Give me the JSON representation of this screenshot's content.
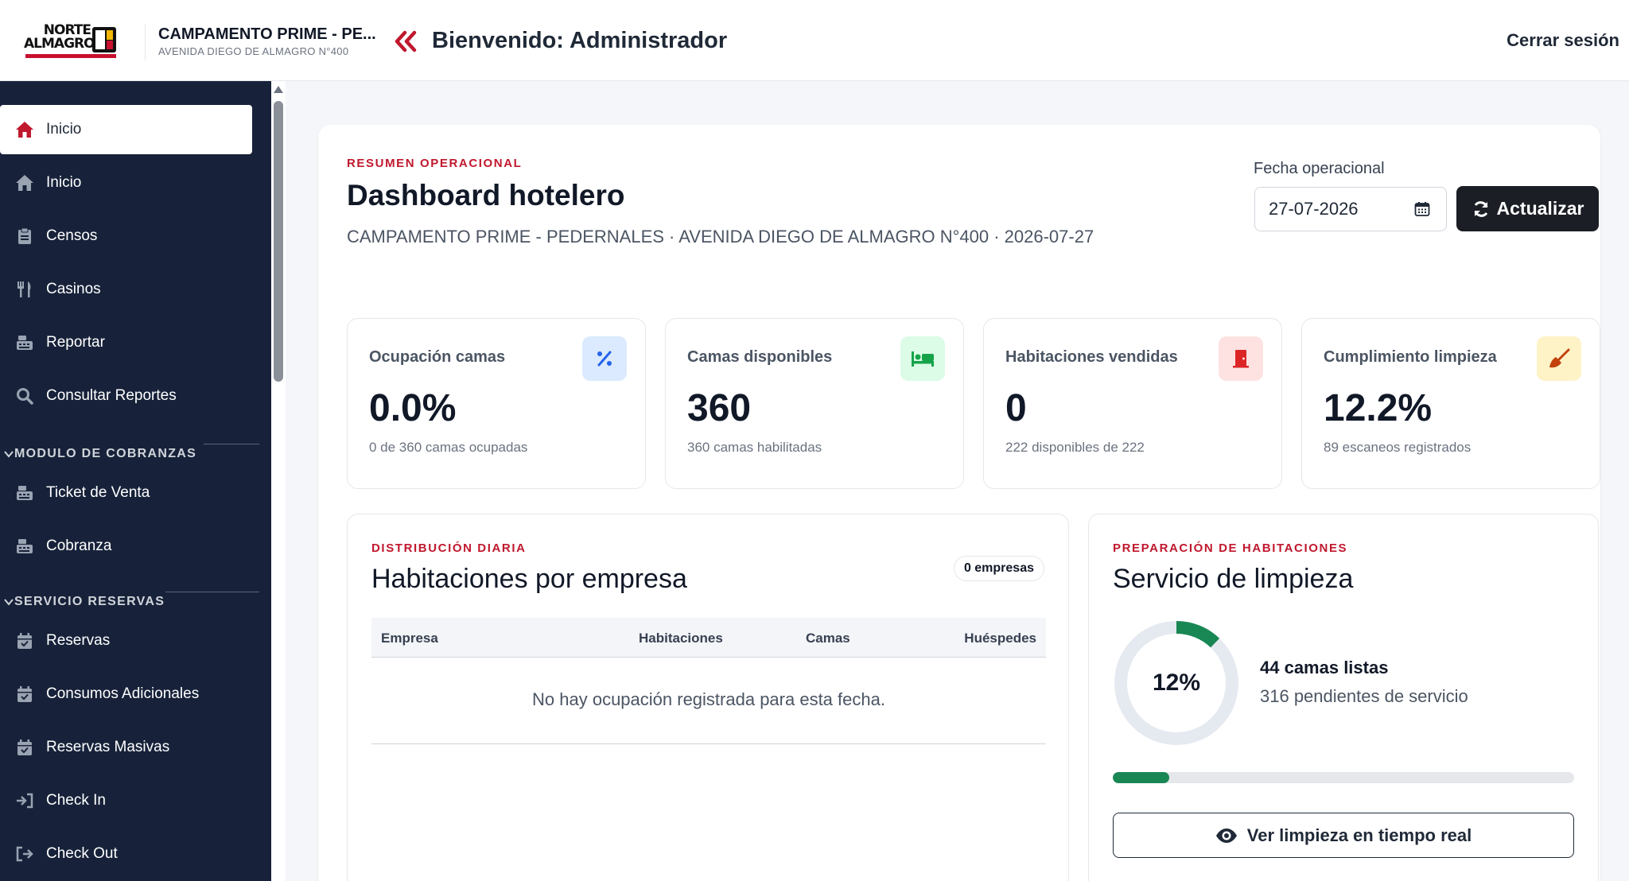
{
  "header": {
    "logo_line1": "NORTE",
    "logo_line2": "ALMAGRO",
    "camp_name": "CAMPAMENTO PRIME - PE...",
    "camp_address": "AVENIDA DIEGO DE ALMAGRO N°400",
    "welcome": "Bienvenido: Administrador",
    "logout": "Cerrar sesión"
  },
  "sidebar": {
    "items": [
      {
        "label": "Inicio",
        "icon": "home-icon",
        "active": true
      },
      {
        "label": "Inicio",
        "icon": "home-icon"
      },
      {
        "label": "Censos",
        "icon": "clipboard-icon"
      },
      {
        "label": "Casinos",
        "icon": "utensils-icon"
      },
      {
        "label": "Reportar",
        "icon": "cash-register-icon"
      },
      {
        "label": "Consultar Reportes",
        "icon": "search-icon"
      }
    ],
    "section_cobranzas": "MODULO DE COBRANZAS",
    "cobranzas_items": [
      {
        "label": "Ticket de Venta",
        "icon": "cash-register-icon"
      },
      {
        "label": "Cobranza",
        "icon": "cash-register-icon"
      }
    ],
    "section_reservas": "SERVICIO RESERVAS",
    "reservas_items": [
      {
        "label": "Reservas",
        "icon": "calendar-check-icon"
      },
      {
        "label": "Consumos Adicionales",
        "icon": "calendar-check-icon"
      },
      {
        "label": "Reservas Masivas",
        "icon": "calendar-check-icon"
      },
      {
        "label": "Check In",
        "icon": "sign-in-icon"
      },
      {
        "label": "Check Out",
        "icon": "sign-out-icon"
      }
    ]
  },
  "dashboard": {
    "eyebrow": "RESUMEN OPERACIONAL",
    "title": "Dashboard hotelero",
    "subtitle": "CAMPAMENTO PRIME - PEDERNALES · AVENIDA DIEGO DE ALMAGRO N°400 · 2026-07-27",
    "date_label": "Fecha operacional",
    "date_value": "27-07-2026",
    "refresh_label": "Actualizar"
  },
  "kpis": [
    {
      "label": "Ocupación camas",
      "value": "0.0%",
      "sub": "0 de 360 camas ocupadas",
      "icon": "percent-icon",
      "color": "#2563eb",
      "bg": "#dbeafe"
    },
    {
      "label": "Camas disponibles",
      "value": "360",
      "sub": "360 camas habilitadas",
      "icon": "bed-icon",
      "color": "#16a34a",
      "bg": "#dcfce7"
    },
    {
      "label": "Habitaciones vendidas",
      "value": "0",
      "sub": "222 disponibles de 222",
      "icon": "door-icon",
      "color": "#dc2626",
      "bg": "#fee2e2"
    },
    {
      "label": "Cumplimiento limpieza",
      "value": "12.2%",
      "sub": "89 escaneos registrados",
      "icon": "broom-icon",
      "color": "#c2410c",
      "bg": "#fef3c7"
    }
  ],
  "distribution": {
    "eyebrow": "DISTRIBUCIÓN DIARIA",
    "title": "Habitaciones por empresa",
    "badge": "0 empresas",
    "columns": [
      "Empresa",
      "Habitaciones",
      "Camas",
      "Huéspedes"
    ],
    "empty_message": "No hay ocupación registrada para esta fecha."
  },
  "cleaning": {
    "eyebrow": "PREPARACIÓN DE HABITACIONES",
    "title": "Servicio de limpieza",
    "percent_label": "12%",
    "ready_fraction": 0.122,
    "ready": "44 camas listas",
    "pending": "316 pendientes de servicio",
    "button_label": "Ver limpieza en tiempo real",
    "accent": "#198754"
  }
}
